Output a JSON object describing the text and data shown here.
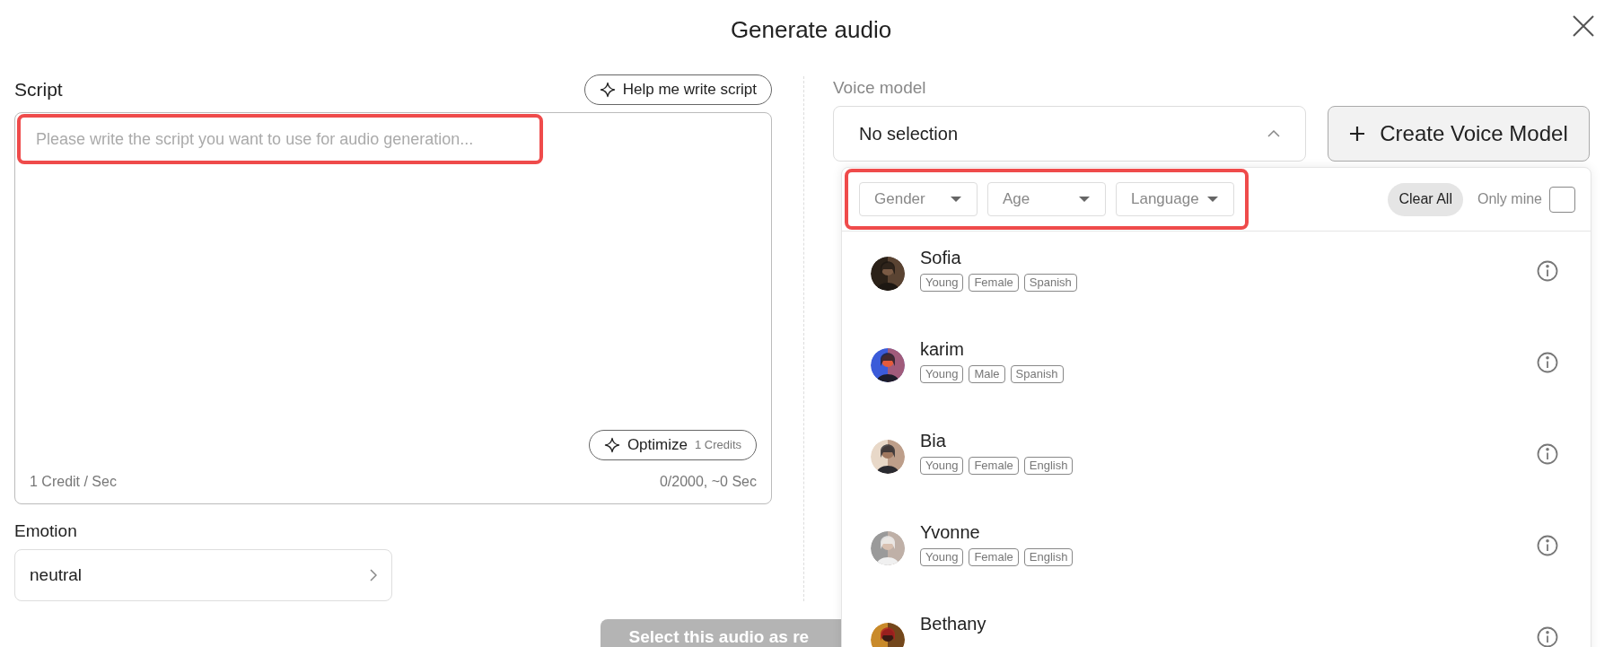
{
  "dialog": {
    "title": "Generate audio"
  },
  "script": {
    "label": "Script",
    "help_button": "Help me write script",
    "placeholder": "Please write the script you want to use for audio generation...",
    "placeholder_highlighted": true,
    "optimize_button": "Optimize",
    "optimize_cost": "1 Credits",
    "rate": "1 Credit / Sec",
    "counter": "0/2000, ~0 Sec"
  },
  "emotion": {
    "label": "Emotion",
    "value": "neutral"
  },
  "voice_model": {
    "label": "Voice model",
    "value": "No selection",
    "expanded": true,
    "create_button": "Create Voice Model"
  },
  "dropdown": {
    "filters_highlighted": true,
    "filters": [
      {
        "label": "Gender"
      },
      {
        "label": "Age"
      },
      {
        "label": "Language"
      }
    ],
    "clear_button": "Clear All",
    "only_mine": {
      "label": "Only mine",
      "checked": false
    },
    "voices": [
      {
        "name": "Sofia",
        "tags": [
          "Young",
          "Female",
          "Spanish"
        ]
      },
      {
        "name": "karim",
        "tags": [
          "Young",
          "Male",
          "Spanish"
        ]
      },
      {
        "name": "Bia",
        "tags": [
          "Young",
          "Female",
          "English"
        ]
      },
      {
        "name": "Yvonne",
        "tags": [
          "Young",
          "Female",
          "English"
        ]
      },
      {
        "name": "Bethany"
      }
    ]
  },
  "footer": {
    "button": "Select this audio as re"
  }
}
